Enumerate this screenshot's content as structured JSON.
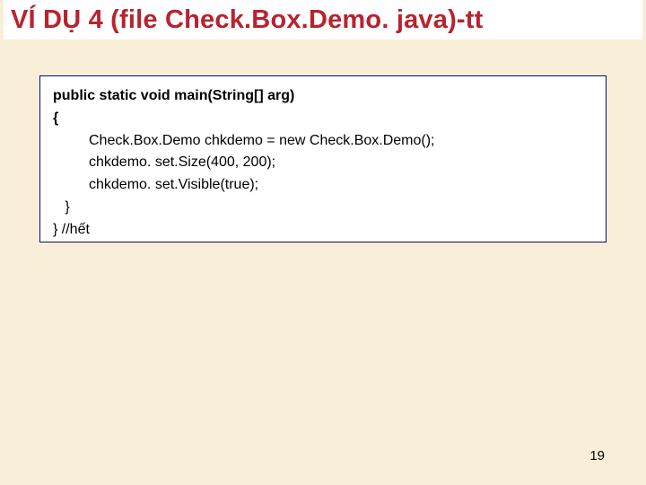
{
  "slide": {
    "title": "VÍ DỤ 4 (file Check.Box.Demo. java)-tt",
    "page_number": "19"
  },
  "code": {
    "l1": "public static void main(String[] arg)",
    "l2": "{",
    "l3": "Check.Box.Demo chkdemo = new Check.Box.Demo();",
    "l4": "chkdemo. set.Size(400, 200);",
    "l5": "chkdemo. set.Visible(true);",
    "l6": "   }",
    "l7": "} //hết"
  }
}
